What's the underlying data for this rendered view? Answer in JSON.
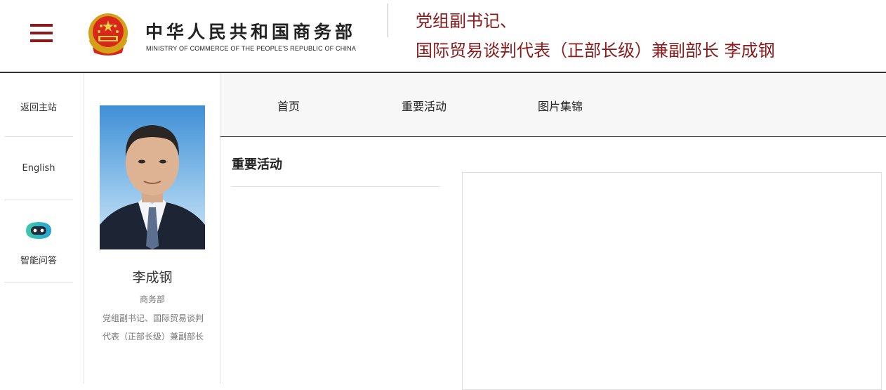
{
  "header": {
    "ministry_cn": "中华人民共和国商务部",
    "ministry_en": "MINISTRY OF COMMERCE OF THE PEOPLE'S REPUBLIC OF CHINA",
    "title_line1": "党组副书记、",
    "title_line2": "国际贸易谈判代表（正部长级）兼副部长 李成钢",
    "accent_color": "#8b1a1a"
  },
  "leftnav": {
    "items": [
      {
        "label": "返回主站"
      },
      {
        "label": "English"
      },
      {
        "label": "智能问答",
        "icon": "robot-chat-icon"
      }
    ]
  },
  "profile": {
    "name": "李成钢",
    "dept": "商务部",
    "title_line1": "党组副书记、国际贸易谈判",
    "title_line2": "代表（正部长级）兼副部长"
  },
  "tabs": [
    {
      "label": "首页"
    },
    {
      "label": "重要活动"
    },
    {
      "label": "图片集锦"
    }
  ],
  "section": {
    "title": "重要活动"
  }
}
